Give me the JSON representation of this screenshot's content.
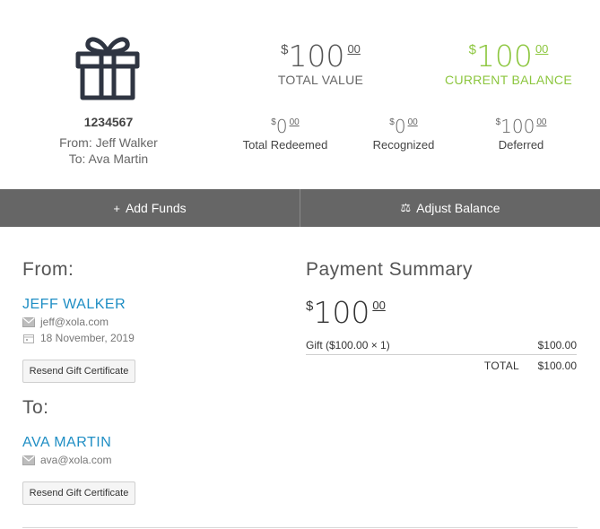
{
  "certificate": {
    "id": "1234567",
    "from_text": "From: Jeff Walker",
    "to_text": "To: Ava Martin"
  },
  "stats": {
    "total_value": {
      "currency": "$",
      "whole": "100",
      "cents": "00",
      "label": "TOTAL VALUE"
    },
    "current_balance": {
      "currency": "$",
      "whole": "100",
      "cents": "00",
      "label": "CURRENT BALANCE"
    },
    "total_redeemed": {
      "currency": "$",
      "whole": "0",
      "cents": "00",
      "label": "Total Redeemed"
    },
    "recognized": {
      "currency": "$",
      "whole": "0",
      "cents": "00",
      "label": "Recognized"
    },
    "deferred": {
      "currency": "$",
      "whole": "100",
      "cents": "00",
      "label": "Deferred"
    }
  },
  "actions": {
    "add_funds": "Add Funds",
    "add_funds_icon": "+",
    "adjust_balance": "Adjust Balance",
    "adjust_balance_icon": "⚖"
  },
  "from_section": {
    "title": "From:",
    "name": "JEFF WALKER",
    "email": "jeff@xola.com",
    "date": "18 November, 2019",
    "resend_label": "Resend Gift Certificate"
  },
  "to_section": {
    "title": "To:",
    "name": "AVA MARTIN",
    "email": "ava@xola.com",
    "resend_label": "Resend Gift Certificate"
  },
  "payment_summary": {
    "title": "Payment Summary",
    "total": {
      "currency": "$",
      "whole": "100",
      "cents": "00"
    },
    "line_items": [
      {
        "description": "Gift ($100.00 × 1)",
        "amount": "$100.00"
      }
    ],
    "total_label": "TOTAL",
    "total_amount": "$100.00"
  },
  "colors": {
    "accent_green": "#8cc63e",
    "link_blue": "#1f8ec4",
    "action_bar": "#666666",
    "icon_navy": "#2f3542"
  },
  "icons": [
    "gift-icon",
    "plus-icon",
    "scale-icon",
    "envelope-icon",
    "calendar-icon"
  ]
}
